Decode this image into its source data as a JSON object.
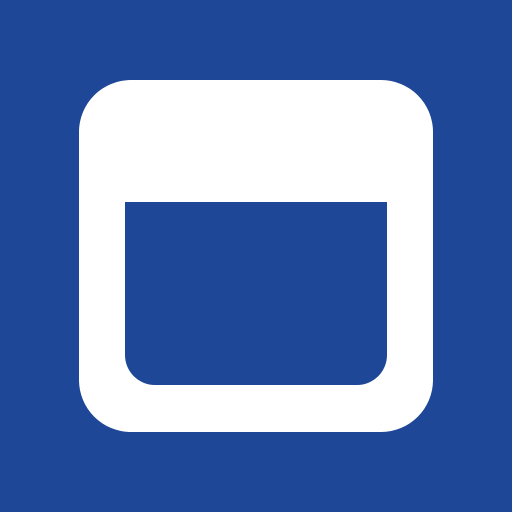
{
  "icon": {
    "name": "browser-window-icon",
    "colors": {
      "background": "#1f4797",
      "foreground": "#ffffff"
    }
  }
}
